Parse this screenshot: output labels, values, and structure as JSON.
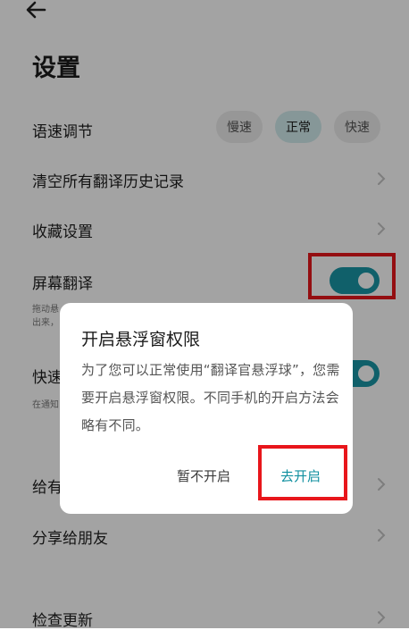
{
  "header": {
    "title": "设置",
    "back_icon": "arrow-left-icon"
  },
  "speech_rate": {
    "label": "语速调节",
    "options": [
      "慢速",
      "正常",
      "快速"
    ],
    "selected": "正常"
  },
  "clear_history": {
    "label": "清空所有翻译历史记录"
  },
  "favorites": {
    "label": "收藏设置"
  },
  "screen_translate": {
    "label": "屏幕翻译",
    "desc_line1": "拖动悬",
    "desc_line2": "出来，",
    "enabled": true
  },
  "quick": {
    "label_partial": "快速",
    "desc_partial": "在通知",
    "enabled": true
  },
  "rate_us": {
    "label_partial": "给有"
  },
  "share": {
    "label": "分享给朋友"
  },
  "check_update": {
    "label": "检查更新"
  },
  "dialog": {
    "title": "开启悬浮窗权限",
    "body": "为了您可以正常使用“翻译官悬浮球”，您需要开启悬浮窗权限。不同手机的开启方法会略有不同。",
    "cancel_label": "暂不开启",
    "confirm_label": "去开启"
  },
  "colors": {
    "accent": "#1a97a6",
    "highlight_box": "#e8161b"
  }
}
